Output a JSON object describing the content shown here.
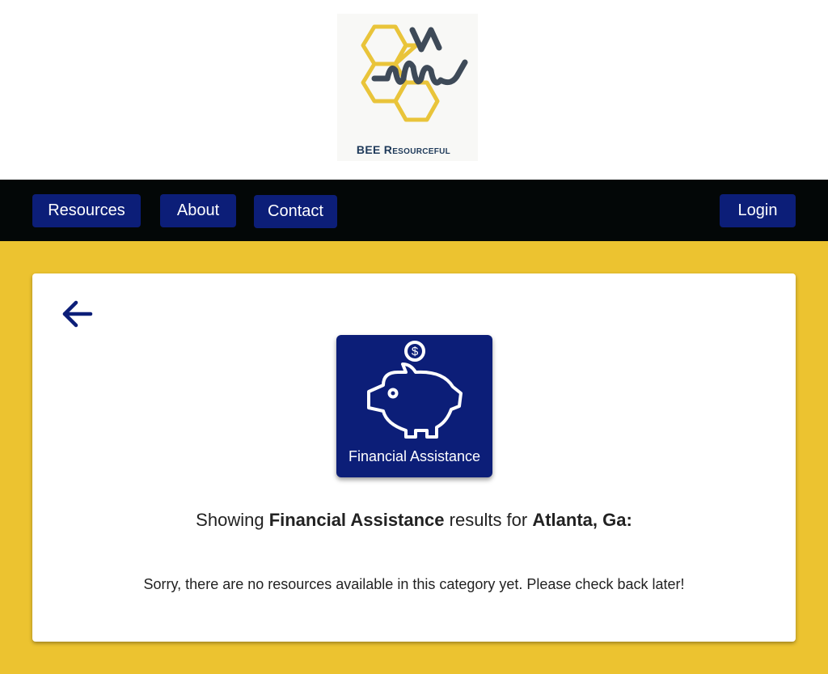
{
  "logo": {
    "text": "BEE Resourceful",
    "icon": "bee-honeycomb-logo"
  },
  "nav": {
    "resources": "Resources",
    "about": "About",
    "contact": "Contact",
    "login": "Login"
  },
  "back": {
    "icon": "arrow-left-icon"
  },
  "category": {
    "label": "Financial Assistance",
    "icon": "piggy-bank-icon"
  },
  "results": {
    "prefix": "Showing ",
    "category": "Financial Assistance",
    "middle": " results for ",
    "location": "Atlanta, Ga:"
  },
  "empty_message": "Sorry, there are no resources available in this category yet. Please check back later!",
  "colors": {
    "brand_navy": "#0c1e78",
    "brand_yellow": "#ecc330",
    "nav_black": "#030707"
  }
}
